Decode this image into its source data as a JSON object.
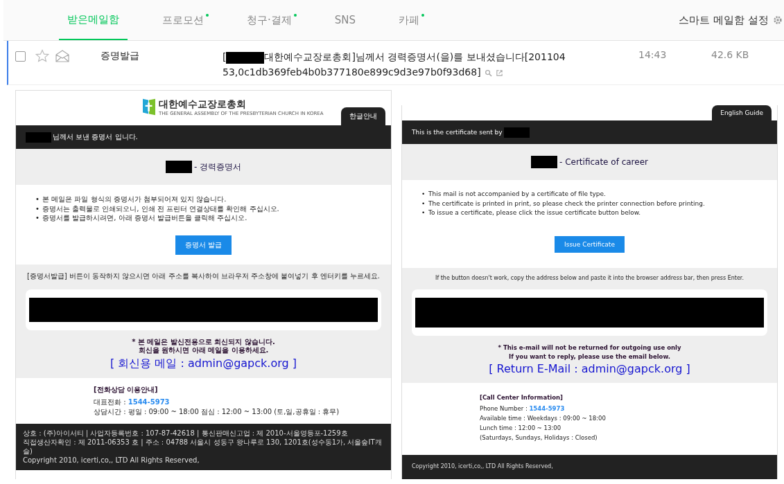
{
  "tabs": [
    {
      "label": "받은메일함",
      "selected": true,
      "has_new": false
    },
    {
      "label": "프로모션",
      "selected": false,
      "has_new": true
    },
    {
      "label": "청구·결제",
      "selected": false,
      "has_new": true
    },
    {
      "label": "SNS",
      "selected": false,
      "has_new": false
    },
    {
      "label": "카페",
      "selected": false,
      "has_new": true
    }
  ],
  "smart_settings": "스마트 메일함 설정",
  "message": {
    "checked": false,
    "starred": false,
    "read": true,
    "sender": "증명발급",
    "subject_start": "[",
    "subject_rest": "대한예수교장로총회]님께서 경력증명서(을)를 보내셨습니다[201104 53,0c1db369feb4b0b377180e899c9d3e97b0f93d68]",
    "time": "14:43",
    "size": "42.6 KB"
  },
  "panels": [
    {
      "logo": {
        "name": "대한예수교장로총회",
        "subtitle": "THE GENERAL ASSEMBLY OF THE PRESBYTERIAN CHURCH IN KOREA"
      },
      "kind": "korean",
      "tab": "한글안내",
      "bullet": "•",
      "sender_line": "님께서 보낸 증명서 입니다.",
      "title": "- 경력증명서",
      "bullets": [
        "본 메일은 파일 형식의 증명서가 첨부되어져 있지 않습니다.",
        "증명서는 출력물로 인쇄되오니, 인쇄 전 프린터 연결상태를 확인해 주십시오.",
        "증명서를 발급하시려면, 아래 증명서 발급버튼을 클릭해 주십시오."
      ],
      "button": "증명서 발급",
      "fallback": "[증명서발급] 버튼이 동작하지 않으시면 아래 주소를 복사하여 브라우저 주소창에 붙여넣기 후 엔터키를 누르세요.",
      "notice": [
        "* 본 메일은 발신전용으로 회신되지 않습니다.",
        "회신을 원하시면 아래 메일을 이용하세요."
      ],
      "reply_email": "[ 회신용 메일 : admin@gapck.org ]",
      "contact": {
        "heading": "[전화상담 이용안내]",
        "phone_label": "대표전화 :",
        "phone": "1544-5973",
        "lines": [
          "상담시간 : 평일 : 09:00 ~ 18:00 점심 : 12:00 ~ 13:00 (토,일,공휴일 : 휴무)"
        ]
      },
      "footer": [
        "상호 : (주)아이서티 | 사업자등록번호 : 107-87-42618 | 통신판매신고업 : 제 2010-서울영등포-1259호",
        "직접생산자확인 : 제 2011-06353 호 | 주소 : 04788 서울시 성동구 왕나루로 130, 1201호(성수동1가, 서울숲IT캐슬)",
        "Copyright 2010, icerti,co,, LTD All Rights Reserved,"
      ]
    },
    {
      "kind": "english",
      "tab": "English Guide",
      "bullet": "•",
      "sender_line": "This is the certificate sent by",
      "title": "- Certificate of career",
      "bullets": [
        "This mail is not accompanied by a certificate of file type.",
        "The certificate is printed in print, so please check the printer connection before printing.",
        "To issue a certificate, please click the issue certificate button below."
      ],
      "button": "Issue Certificate",
      "fallback": "If the button doesn't work, copy the address below and paste it into the browser address bar, then press Enter.",
      "notice": [
        "* This e-mail will not be returned for outgoing use only",
        "If you want to reply, please use the email below."
      ],
      "reply_email": "[ Return E-Mail : admin@gapck.org ]",
      "contact": {
        "heading": "[Call Center Information]",
        "phone_label": "Phone Number :",
        "phone": "1544-5973",
        "lines": [
          "Available time : Weekdays : 09:00 ~ 18:00",
          "Lunch time : 12:00 ~ 13:00",
          "(Saturdays, Sundays, Holidays : Closed)"
        ]
      },
      "footer": [
        "Copyright 2010, icerti,co,, LTD All Rights Reserved,"
      ]
    }
  ]
}
